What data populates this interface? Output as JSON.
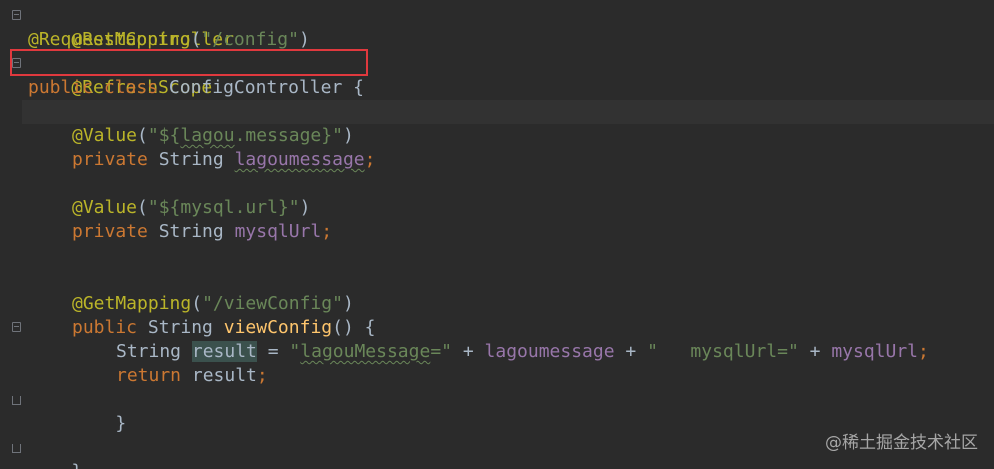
{
  "code": {
    "line1_annotation": "@RestController",
    "line2_annotation": "@RequestMapping",
    "line2_open": "(",
    "line2_string": "\"/config\"",
    "line2_close": ")",
    "line3_annotation": "@RefreshScope",
    "line4_kw_public": "public",
    "line4_kw_class": "class",
    "line4_classname": "ConfigController",
    "line4_brace": "{",
    "line6_annotation": "@Value",
    "line6_open": "(",
    "line6_str_prefix": "\"${",
    "line6_str_key": "lagou",
    "line6_str_suffix": ".message}\"",
    "line6_close": ")",
    "line7_kw_private": "private",
    "line7_type": "String",
    "line7_field": "lagoumessage",
    "line7_semi": ";",
    "line9_annotation": "@Value",
    "line9_open": "(",
    "line9_string": "\"${mysql.url}\"",
    "line9_close": ")",
    "line10_kw_private": "private",
    "line10_type": "String",
    "line10_field": "mysqlUrl",
    "line10_semi": ";",
    "line13_annotation": "@GetMapping",
    "line13_open": "(",
    "line13_string": "\"/viewConfig\"",
    "line13_close": ")",
    "line14_kw_public": "public",
    "line14_type": "String",
    "line14_method": "viewConfig",
    "line14_parens": "() {",
    "line15_type": "String",
    "line15_var": "result",
    "line15_eq": " = ",
    "line15_str1_open": "\"",
    "line15_str1_key": "lagouMessage",
    "line15_str1_close": "=\"",
    "line15_plus1": " + ",
    "line15_field1": "lagoumessage",
    "line15_plus2": " + ",
    "line15_str2": "\"   mysqlUrl=\"",
    "line15_plus3": " + ",
    "line15_field2": "mysqlUrl",
    "line15_semi": ";",
    "line16_kw_return": "return",
    "line16_var": "result",
    "line16_semi": ";",
    "line17_brace": "}",
    "line19_brace": "}"
  },
  "watermark": "@稀土掘金技术社区",
  "colors": {
    "background": "#2b2b2b",
    "annotation": "#bbb529",
    "keyword": "#cc7832",
    "string": "#6a8759",
    "field": "#9876aa",
    "method": "#ffc66d",
    "text": "#a9b7c6",
    "highlight_box": "#e0393e"
  }
}
